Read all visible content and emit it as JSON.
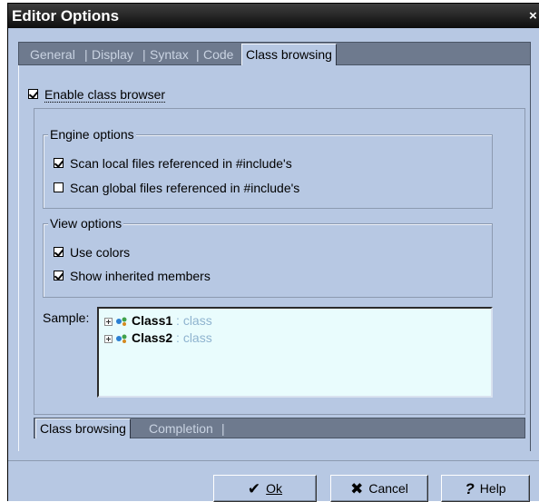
{
  "window": {
    "title": "Editor Options",
    "close_glyph": "×"
  },
  "tabs": {
    "items": [
      {
        "label": "General"
      },
      {
        "label": "Display"
      },
      {
        "label": "Syntax"
      },
      {
        "label": "Code"
      },
      {
        "label": "Class browsing"
      }
    ],
    "separator": "|",
    "active": "Class browsing"
  },
  "enable_class_browser": {
    "label": "Enable class browser",
    "checked": true
  },
  "engine_options": {
    "title": "Engine options",
    "scan_local": {
      "label": "Scan local files referenced in #include's",
      "checked": true
    },
    "scan_global": {
      "label": "Scan global files referenced in #include's",
      "checked": false
    }
  },
  "view_options": {
    "title": "View options",
    "use_colors": {
      "label": "Use colors",
      "checked": true
    },
    "show_inherited": {
      "label": "Show inherited members",
      "checked": true
    }
  },
  "sample": {
    "label": "Sample:",
    "items": [
      {
        "name": "Class1",
        "kind": ": class"
      },
      {
        "name": "Class2",
        "kind": ": class"
      }
    ]
  },
  "bottom_tabs": {
    "items": [
      {
        "label": "Class browsing"
      },
      {
        "label": "Completion"
      }
    ],
    "separator": "|",
    "active": "Class browsing"
  },
  "buttons": {
    "ok": {
      "label": "Ok",
      "icon": "checkmark-icon"
    },
    "cancel": {
      "label": "Cancel",
      "icon": "x-icon"
    },
    "help": {
      "label": "Help",
      "icon": "question-icon"
    }
  },
  "colors": {
    "dialog_bg": "#b7c8e3",
    "tabstrip_bg": "#6e7a8e",
    "tree_bg": "#e9fcfd",
    "class_kind": "#8fb3cf"
  }
}
